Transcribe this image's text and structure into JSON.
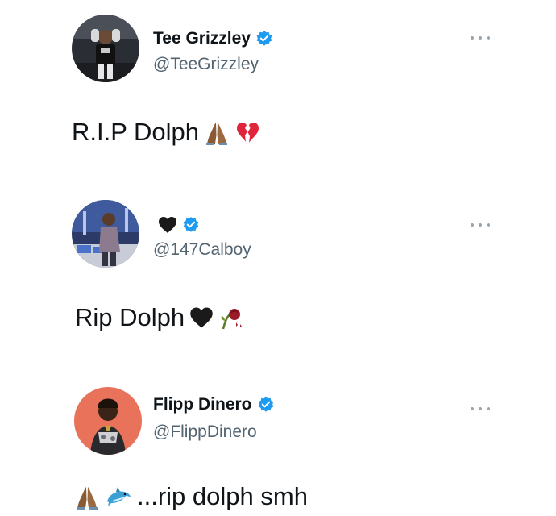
{
  "tweets": [
    {
      "display_name": "Tee Grizzley",
      "verified": true,
      "handle": "@TeeGrizzley",
      "text": "R.I.P Dolph",
      "emojis": [
        "folded-hands-icon",
        "broken-heart-icon"
      ]
    },
    {
      "display_name": "",
      "name_emoji": "black-heart-icon",
      "verified": true,
      "handle": "@147Calboy",
      "text": "Rip Dolph",
      "emojis": [
        "black-heart-icon",
        "wilted-rose-icon"
      ]
    },
    {
      "display_name": "Flipp Dinero",
      "verified": true,
      "handle": "@FlippDinero",
      "text": "...rip dolph smh",
      "emojis_before": [
        "folded-hands-icon",
        "dolphin-icon"
      ]
    }
  ],
  "colors": {
    "verified": "#1d9bf0",
    "handle": "#536471",
    "text": "#0f1419",
    "more_dots": "#9aa4ad"
  }
}
